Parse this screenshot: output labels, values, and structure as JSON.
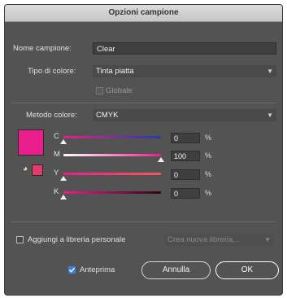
{
  "dialog": {
    "title": "Opzioni campione"
  },
  "form": {
    "name_label": "Nome campione:",
    "name_value": "Clear",
    "color_type_label": "Tipo di colore:",
    "color_type_value": "Tinta piatta",
    "global_label": "Globale",
    "global_checked": true,
    "color_mode_label": "Metodo colore:",
    "color_mode_value": "CMYK"
  },
  "swatch": {
    "color": "#ea1e8c",
    "small_color": "#e23a6a"
  },
  "sliders": [
    {
      "label": "C",
      "value": "0",
      "unit": "%",
      "fraction": 0.0
    },
    {
      "label": "M",
      "value": "100",
      "unit": "%",
      "fraction": 1.0
    },
    {
      "label": "Y",
      "value": "0",
      "unit": "%",
      "fraction": 0.0
    },
    {
      "label": "K",
      "value": "0",
      "unit": "%",
      "fraction": 0.0
    }
  ],
  "library": {
    "checkbox_label": "Aggiungi a libreria personale",
    "checked": false,
    "dropdown_placeholder": "Crea nuova libreria..."
  },
  "footer": {
    "preview_label": "Anteprima",
    "preview_checked": true,
    "cancel_label": "Annulla",
    "ok_label": "OK"
  }
}
